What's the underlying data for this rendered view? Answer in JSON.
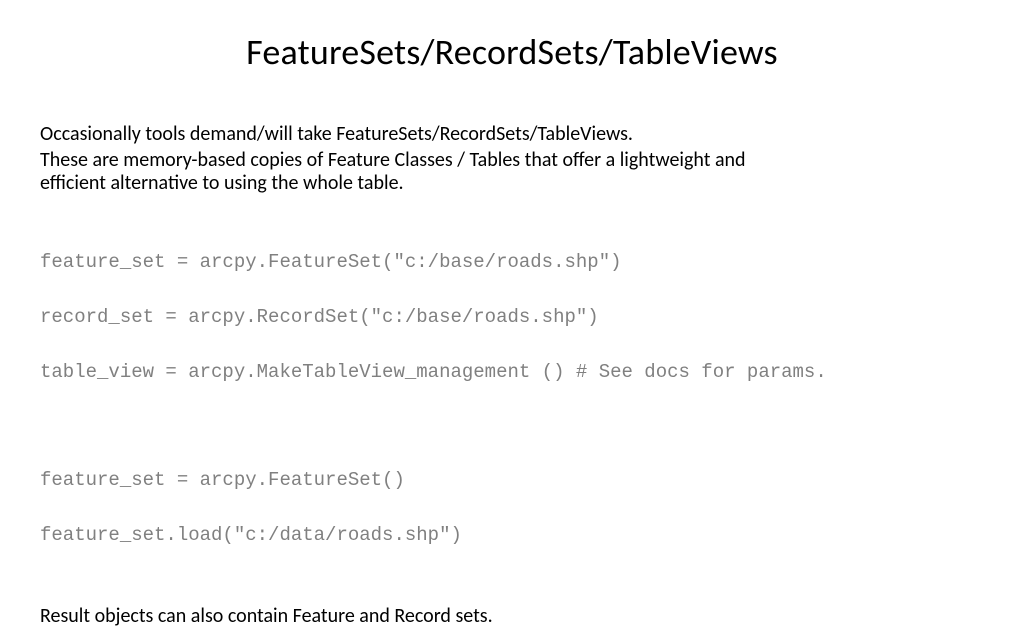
{
  "title": "FeatureSets/RecordSets/TableViews",
  "para1": "Occasionally tools demand/will take FeatureSets/RecordSets/TableViews.",
  "para2a": "These are memory-based copies of Feature Classes / Tables that offer a lightweight and",
  "para2b": "efficient alternative to using the whole table.",
  "code1_line1": "feature_set = arcpy.FeatureSet(\"c:/base/roads.shp\")",
  "code1_line2": "record_set = arcpy.RecordSet(\"c:/base/roads.shp\")",
  "code1_line3": "table_view = arcpy.MakeTableView_management () # See docs for params.",
  "code2_line1": "feature_set = arcpy.FeatureSet()",
  "code2_line2": "feature_set.load(\"c:/data/roads.shp\")",
  "closing": "Result objects can also contain Feature and Record sets."
}
